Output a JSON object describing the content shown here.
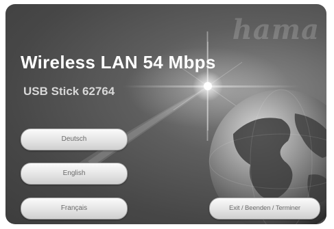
{
  "brand": {
    "logo_text": "hama"
  },
  "header": {
    "title": "Wireless LAN 54 Mbps",
    "subtitle": "USB Stick 62764"
  },
  "language_buttons": [
    {
      "label": "Deutsch"
    },
    {
      "label": "English"
    },
    {
      "label": "Français"
    }
  ],
  "exit_button": {
    "label": "Exit / Beenden / Terminer"
  },
  "colors": {
    "background": "#474747",
    "title_text": "#ffffff",
    "subtitle_text": "#d8d8d8",
    "button_face": "#e2e2e2",
    "button_text": "#6a6a6a"
  },
  "icons": [
    "globe-graphic",
    "light-flare"
  ]
}
